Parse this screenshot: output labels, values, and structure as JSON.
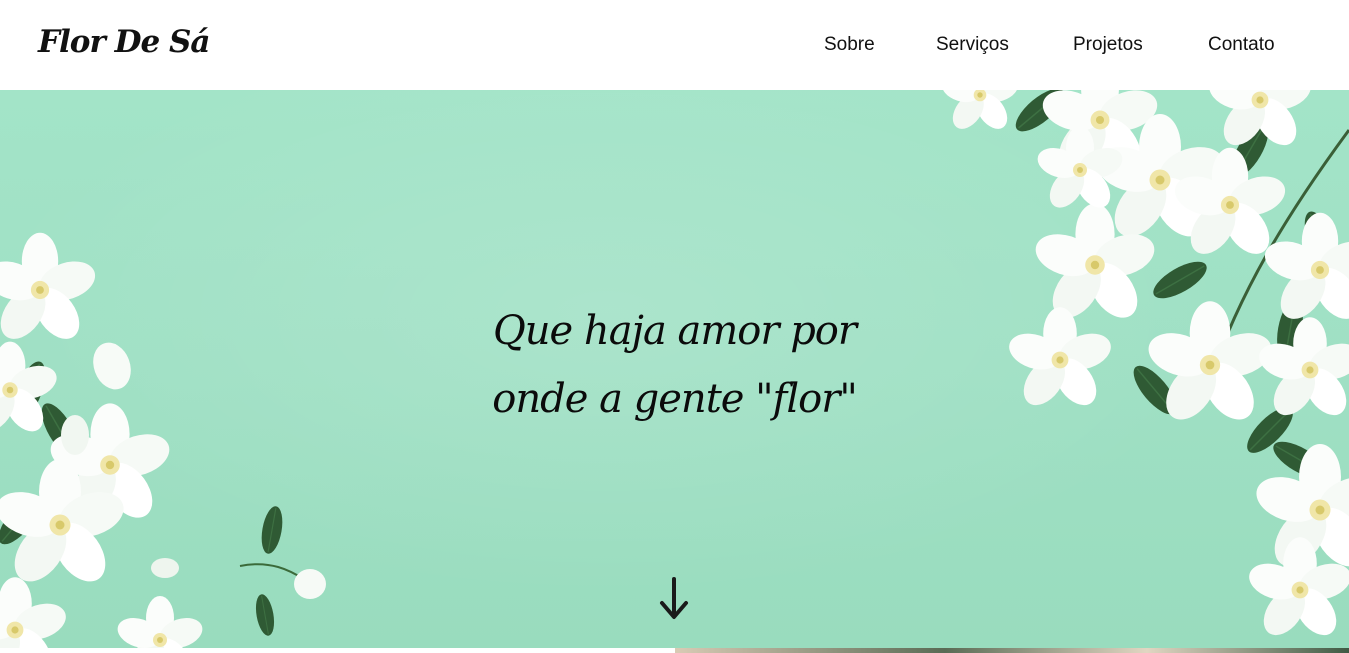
{
  "header": {
    "brand": "Flor De Sá",
    "nav": [
      {
        "label": "Sobre"
      },
      {
        "label": "Serviços"
      },
      {
        "label": "Projetos"
      },
      {
        "label": "Contato"
      }
    ]
  },
  "hero": {
    "headline_line1": "Que haja amor por",
    "headline_line2": "onde a gente \"flor\"",
    "scroll_icon": "arrow-down-icon",
    "background_color": "#a3e4c8"
  }
}
